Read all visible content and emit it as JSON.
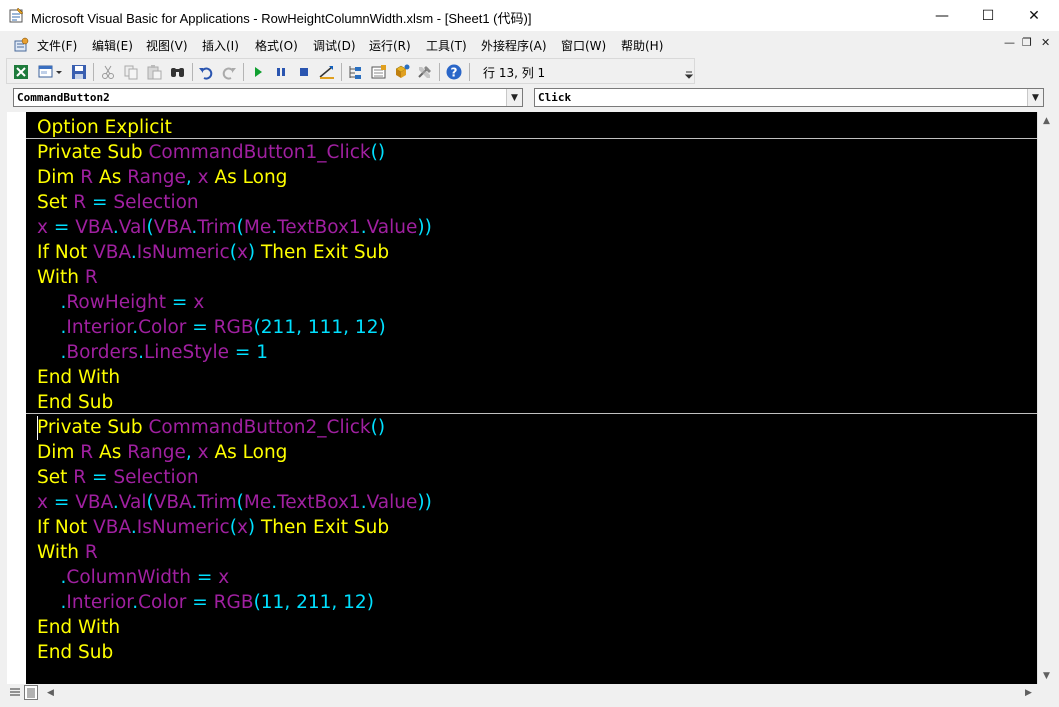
{
  "window": {
    "title": "Microsoft Visual Basic for Applications - RowHeightColumnWidth.xlsm - [Sheet1 (代码)]",
    "minimize": "—",
    "maximize": "☐",
    "close": "✕"
  },
  "menu": {
    "items": [
      "文件(F)",
      "编辑(E)",
      "视图(V)",
      "插入(I)",
      "格式(O)",
      "调试(D)",
      "运行(R)",
      "工具(T)",
      "外接程序(A)",
      "窗口(W)",
      "帮助(H)"
    ],
    "mdi_minimize": "—",
    "mdi_restore": "❐",
    "mdi_close": "✕"
  },
  "toolbar": {
    "icons": [
      "excel-icon",
      "insert-userform-icon",
      "save-icon",
      "cut-icon",
      "copy-icon",
      "paste-icon",
      "find-icon",
      "undo-icon",
      "redo-icon",
      "run-icon",
      "break-icon",
      "reset-icon",
      "design-mode-icon",
      "project-explorer-icon",
      "properties-icon",
      "object-browser-icon",
      "toolbox-icon",
      "help-icon"
    ],
    "cursor_position": "行 13, 列 1"
  },
  "dropdowns": {
    "object": "CommandButton2",
    "procedure": "Click"
  },
  "colors": {
    "background": "#000000",
    "keyword": "#ffff00",
    "identifier": "#a020a0",
    "number_operator": "#00e0ff"
  },
  "code": {
    "lines": [
      [
        [
          "Option Explicit",
          "kw"
        ]
      ],
      [
        [
          "Private Sub ",
          "kw"
        ],
        [
          "CommandButton1_Click",
          "id"
        ],
        [
          "()",
          "nm"
        ]
      ],
      [
        [
          "Dim ",
          "kw"
        ],
        [
          "R",
          "id"
        ],
        [
          " As ",
          "kw"
        ],
        [
          "Range",
          "id"
        ],
        [
          ",",
          "nm"
        ],
        [
          " x",
          "id"
        ],
        [
          " As Long",
          "kw"
        ]
      ],
      [
        [
          "Set ",
          "kw"
        ],
        [
          "R",
          "id"
        ],
        [
          " = ",
          "nm"
        ],
        [
          "Selection",
          "id"
        ]
      ],
      [
        [
          "x",
          "id"
        ],
        [
          " = ",
          "nm"
        ],
        [
          "VBA",
          "id"
        ],
        [
          ".",
          "nm"
        ],
        [
          "Val",
          "id"
        ],
        [
          "(",
          "nm"
        ],
        [
          "VBA",
          "id"
        ],
        [
          ".",
          "nm"
        ],
        [
          "Trim",
          "id"
        ],
        [
          "(",
          "nm"
        ],
        [
          "Me",
          "id"
        ],
        [
          ".",
          "nm"
        ],
        [
          "TextBox1",
          "id"
        ],
        [
          ".",
          "nm"
        ],
        [
          "Value",
          "id"
        ],
        [
          "))",
          "nm"
        ]
      ],
      [
        [
          "If Not ",
          "kw"
        ],
        [
          "VBA",
          "id"
        ],
        [
          ".",
          "nm"
        ],
        [
          "IsNumeric",
          "id"
        ],
        [
          "(",
          "nm"
        ],
        [
          "x",
          "id"
        ],
        [
          ")",
          "nm"
        ],
        [
          " Then Exit Sub",
          "kw"
        ]
      ],
      [
        [
          "With ",
          "kw"
        ],
        [
          "R",
          "id"
        ]
      ],
      [
        [
          "    .",
          "nm"
        ],
        [
          "RowHeight",
          "id"
        ],
        [
          " = ",
          "nm"
        ],
        [
          "x",
          "id"
        ]
      ],
      [
        [
          "    .",
          "nm"
        ],
        [
          "Interior",
          "id"
        ],
        [
          ".",
          "nm"
        ],
        [
          "Color",
          "id"
        ],
        [
          " = ",
          "nm"
        ],
        [
          "RGB",
          "id"
        ],
        [
          "(211, 111, 12)",
          "nm"
        ]
      ],
      [
        [
          "    .",
          "nm"
        ],
        [
          "Borders",
          "id"
        ],
        [
          ".",
          "nm"
        ],
        [
          "LineStyle",
          "id"
        ],
        [
          " = 1",
          "nm"
        ]
      ],
      [
        [
          "End With",
          "kw"
        ]
      ],
      [
        [
          "End Sub",
          "kw"
        ]
      ],
      [
        [
          "Private Sub ",
          "kw"
        ],
        [
          "CommandButton2_Click",
          "id"
        ],
        [
          "()",
          "nm"
        ]
      ],
      [
        [
          "Dim ",
          "kw"
        ],
        [
          "R",
          "id"
        ],
        [
          " As ",
          "kw"
        ],
        [
          "Range",
          "id"
        ],
        [
          ",",
          "nm"
        ],
        [
          " x",
          "id"
        ],
        [
          " As Long",
          "kw"
        ]
      ],
      [
        [
          "Set ",
          "kw"
        ],
        [
          "R",
          "id"
        ],
        [
          " = ",
          "nm"
        ],
        [
          "Selection",
          "id"
        ]
      ],
      [
        [
          "x",
          "id"
        ],
        [
          " = ",
          "nm"
        ],
        [
          "VBA",
          "id"
        ],
        [
          ".",
          "nm"
        ],
        [
          "Val",
          "id"
        ],
        [
          "(",
          "nm"
        ],
        [
          "VBA",
          "id"
        ],
        [
          ".",
          "nm"
        ],
        [
          "Trim",
          "id"
        ],
        [
          "(",
          "nm"
        ],
        [
          "Me",
          "id"
        ],
        [
          ".",
          "nm"
        ],
        [
          "TextBox1",
          "id"
        ],
        [
          ".",
          "nm"
        ],
        [
          "Value",
          "id"
        ],
        [
          "))",
          "nm"
        ]
      ],
      [
        [
          "If Not ",
          "kw"
        ],
        [
          "VBA",
          "id"
        ],
        [
          ".",
          "nm"
        ],
        [
          "IsNumeric",
          "id"
        ],
        [
          "(",
          "nm"
        ],
        [
          "x",
          "id"
        ],
        [
          ")",
          "nm"
        ],
        [
          " Then Exit Sub",
          "kw"
        ]
      ],
      [
        [
          "With ",
          "kw"
        ],
        [
          "R",
          "id"
        ]
      ],
      [
        [
          "    .",
          "nm"
        ],
        [
          "ColumnWidth",
          "id"
        ],
        [
          " = ",
          "nm"
        ],
        [
          "x",
          "id"
        ]
      ],
      [
        [
          "    .",
          "nm"
        ],
        [
          "Interior",
          "id"
        ],
        [
          ".",
          "nm"
        ],
        [
          "Color",
          "id"
        ],
        [
          " = ",
          "nm"
        ],
        [
          "RGB",
          "id"
        ],
        [
          "(11, 211, 12)",
          "nm"
        ]
      ],
      [
        [
          "End With",
          "kw"
        ]
      ],
      [
        [
          "End Sub",
          "kw"
        ]
      ]
    ]
  }
}
